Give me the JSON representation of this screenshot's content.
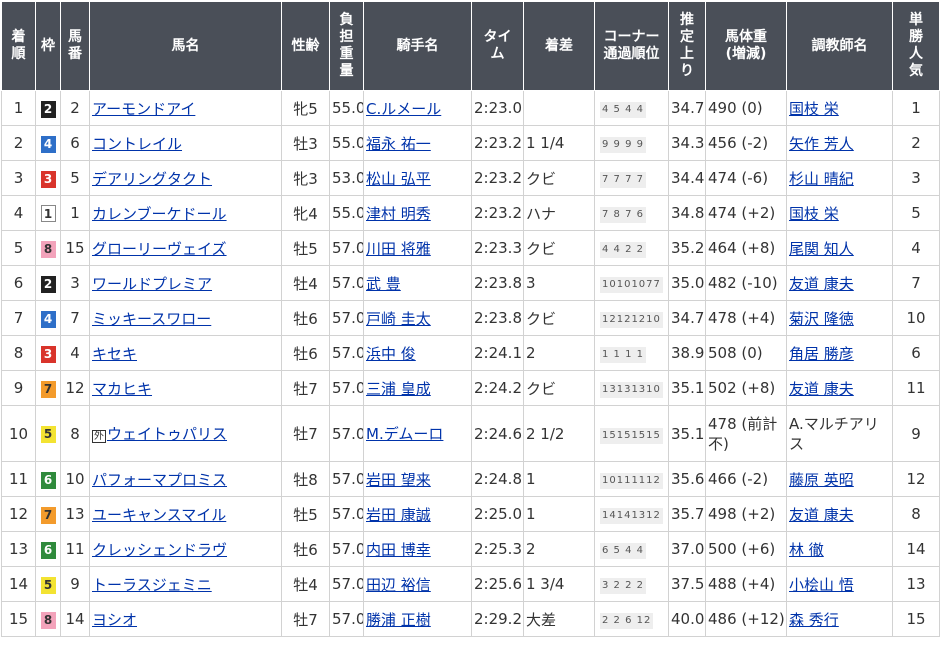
{
  "headers": {
    "rank": "着\n順",
    "waku": "枠",
    "umaban": "馬\n番",
    "horse": "馬名",
    "sexage": "性齢",
    "weight": "負\n担\n重\n量",
    "jockey": "騎手名",
    "time": "タイ\nム",
    "margin": "着差",
    "corner": "コーナー\n通過順位",
    "last3f": "推\n定\n上\nり",
    "bodyweight": "馬体重\n(増減)",
    "trainer": "調教師名",
    "popularity": "単\n勝\n人\n気"
  },
  "rows": [
    {
      "rank": "1",
      "waku": "2",
      "umaban": "2",
      "gai": "",
      "horse": "アーモンドアイ",
      "sexage": "牝5",
      "weight": "55.0",
      "jockey": "C.ルメール",
      "time": "2:23.0",
      "margin": "",
      "corner": "4 5 4 4",
      "last3f": "34.7",
      "bodyweight": "490 (0)",
      "trainer": "国枝 栄",
      "popularity": "1"
    },
    {
      "rank": "2",
      "waku": "4",
      "umaban": "6",
      "gai": "",
      "horse": "コントレイル",
      "sexage": "牡3",
      "weight": "55.0",
      "jockey": "福永 祐一",
      "time": "2:23.2",
      "margin": "1 1/4",
      "corner": "9 9 9 9",
      "last3f": "34.3",
      "bodyweight": "456 (-2)",
      "trainer": "矢作 芳人",
      "popularity": "2"
    },
    {
      "rank": "3",
      "waku": "3",
      "umaban": "5",
      "gai": "",
      "horse": "デアリングタクト",
      "sexage": "牝3",
      "weight": "53.0",
      "jockey": "松山 弘平",
      "time": "2:23.2",
      "margin": "クビ",
      "corner": "7 7 7 7",
      "last3f": "34.4",
      "bodyweight": "474 (-6)",
      "trainer": "杉山 晴紀",
      "popularity": "3"
    },
    {
      "rank": "4",
      "waku": "1",
      "umaban": "1",
      "gai": "",
      "horse": "カレンブーケドール",
      "sexage": "牝4",
      "weight": "55.0",
      "jockey": "津村 明秀",
      "time": "2:23.2",
      "margin": "ハナ",
      "corner": "7 8 7 6",
      "last3f": "34.8",
      "bodyweight": "474 (+2)",
      "trainer": "国枝 栄",
      "popularity": "5"
    },
    {
      "rank": "5",
      "waku": "8",
      "umaban": "15",
      "gai": "",
      "horse": "グローリーヴェイズ",
      "sexage": "牡5",
      "weight": "57.0",
      "jockey": "川田 将雅",
      "time": "2:23.3",
      "margin": "クビ",
      "corner": "4 4 2 2",
      "last3f": "35.2",
      "bodyweight": "464 (+8)",
      "trainer": "尾関 知人",
      "popularity": "4"
    },
    {
      "rank": "6",
      "waku": "2",
      "umaban": "3",
      "gai": "",
      "horse": "ワールドプレミア",
      "sexage": "牡4",
      "weight": "57.0",
      "jockey": "武 豊",
      "time": "2:23.8",
      "margin": "3",
      "corner": "10101077",
      "last3f": "35.0",
      "bodyweight": "482 (-10)",
      "trainer": "友道 康夫",
      "popularity": "7"
    },
    {
      "rank": "7",
      "waku": "4",
      "umaban": "7",
      "gai": "",
      "horse": "ミッキースワロー",
      "sexage": "牡6",
      "weight": "57.0",
      "jockey": "戸崎 圭太",
      "time": "2:23.8",
      "margin": "クビ",
      "corner": "12121210",
      "last3f": "34.7",
      "bodyweight": "478 (+4)",
      "trainer": "菊沢 隆徳",
      "popularity": "10"
    },
    {
      "rank": "8",
      "waku": "3",
      "umaban": "4",
      "gai": "",
      "horse": "キセキ",
      "sexage": "牡6",
      "weight": "57.0",
      "jockey": "浜中 俊",
      "time": "2:24.1",
      "margin": "2",
      "corner": "1 1 1 1",
      "last3f": "38.9",
      "bodyweight": "508 (0)",
      "trainer": "角居 勝彦",
      "popularity": "6"
    },
    {
      "rank": "9",
      "waku": "7",
      "umaban": "12",
      "gai": "",
      "horse": "マカヒキ",
      "sexage": "牡7",
      "weight": "57.0",
      "jockey": "三浦 皇成",
      "time": "2:24.2",
      "margin": "クビ",
      "corner": "13131310",
      "last3f": "35.1",
      "bodyweight": "502 (+8)",
      "trainer": "友道 康夫",
      "popularity": "11"
    },
    {
      "rank": "10",
      "waku": "5",
      "umaban": "8",
      "gai": "外",
      "horse": "ウェイトゥパリス",
      "sexage": "牡7",
      "weight": "57.0",
      "jockey": "M.デムーロ",
      "time": "2:24.6",
      "margin": "2 1/2",
      "corner": "15151515",
      "last3f": "35.1",
      "bodyweight": "478 (前計不)",
      "trainer": "A.マルチアリス",
      "popularity": "9"
    },
    {
      "rank": "11",
      "waku": "6",
      "umaban": "10",
      "gai": "",
      "horse": "パフォーマプロミス",
      "sexage": "牡8",
      "weight": "57.0",
      "jockey": "岩田 望来",
      "time": "2:24.8",
      "margin": "1",
      "corner": "10111112",
      "last3f": "35.6",
      "bodyweight": "466 (-2)",
      "trainer": "藤原 英昭",
      "popularity": "12"
    },
    {
      "rank": "12",
      "waku": "7",
      "umaban": "13",
      "gai": "",
      "horse": "ユーキャンスマイル",
      "sexage": "牡5",
      "weight": "57.0",
      "jockey": "岩田 康誠",
      "time": "2:25.0",
      "margin": "1",
      "corner": "14141312",
      "last3f": "35.7",
      "bodyweight": "498 (+2)",
      "trainer": "友道 康夫",
      "popularity": "8"
    },
    {
      "rank": "13",
      "waku": "6",
      "umaban": "11",
      "gai": "",
      "horse": "クレッシェンドラヴ",
      "sexage": "牡6",
      "weight": "57.0",
      "jockey": "内田 博幸",
      "time": "2:25.3",
      "margin": "2",
      "corner": "6 5 4 4",
      "last3f": "37.0",
      "bodyweight": "500 (+6)",
      "trainer": "林 徹",
      "popularity": "14"
    },
    {
      "rank": "14",
      "waku": "5",
      "umaban": "9",
      "gai": "",
      "horse": "トーラスジェミニ",
      "sexage": "牡4",
      "weight": "57.0",
      "jockey": "田辺 裕信",
      "time": "2:25.6",
      "margin": "1 3/4",
      "corner": "3 2 2 2",
      "last3f": "37.5",
      "bodyweight": "488 (+4)",
      "trainer": "小桧山 悟",
      "popularity": "13"
    },
    {
      "rank": "15",
      "waku": "8",
      "umaban": "14",
      "gai": "",
      "horse": "ヨシオ",
      "sexage": "牡7",
      "weight": "57.0",
      "jockey": "勝浦 正樹",
      "time": "2:29.2",
      "margin": "大差",
      "corner": "2 2 6 12",
      "last3f": "40.0",
      "bodyweight": "486 (+12)",
      "trainer": "森 秀行",
      "popularity": "15"
    }
  ]
}
